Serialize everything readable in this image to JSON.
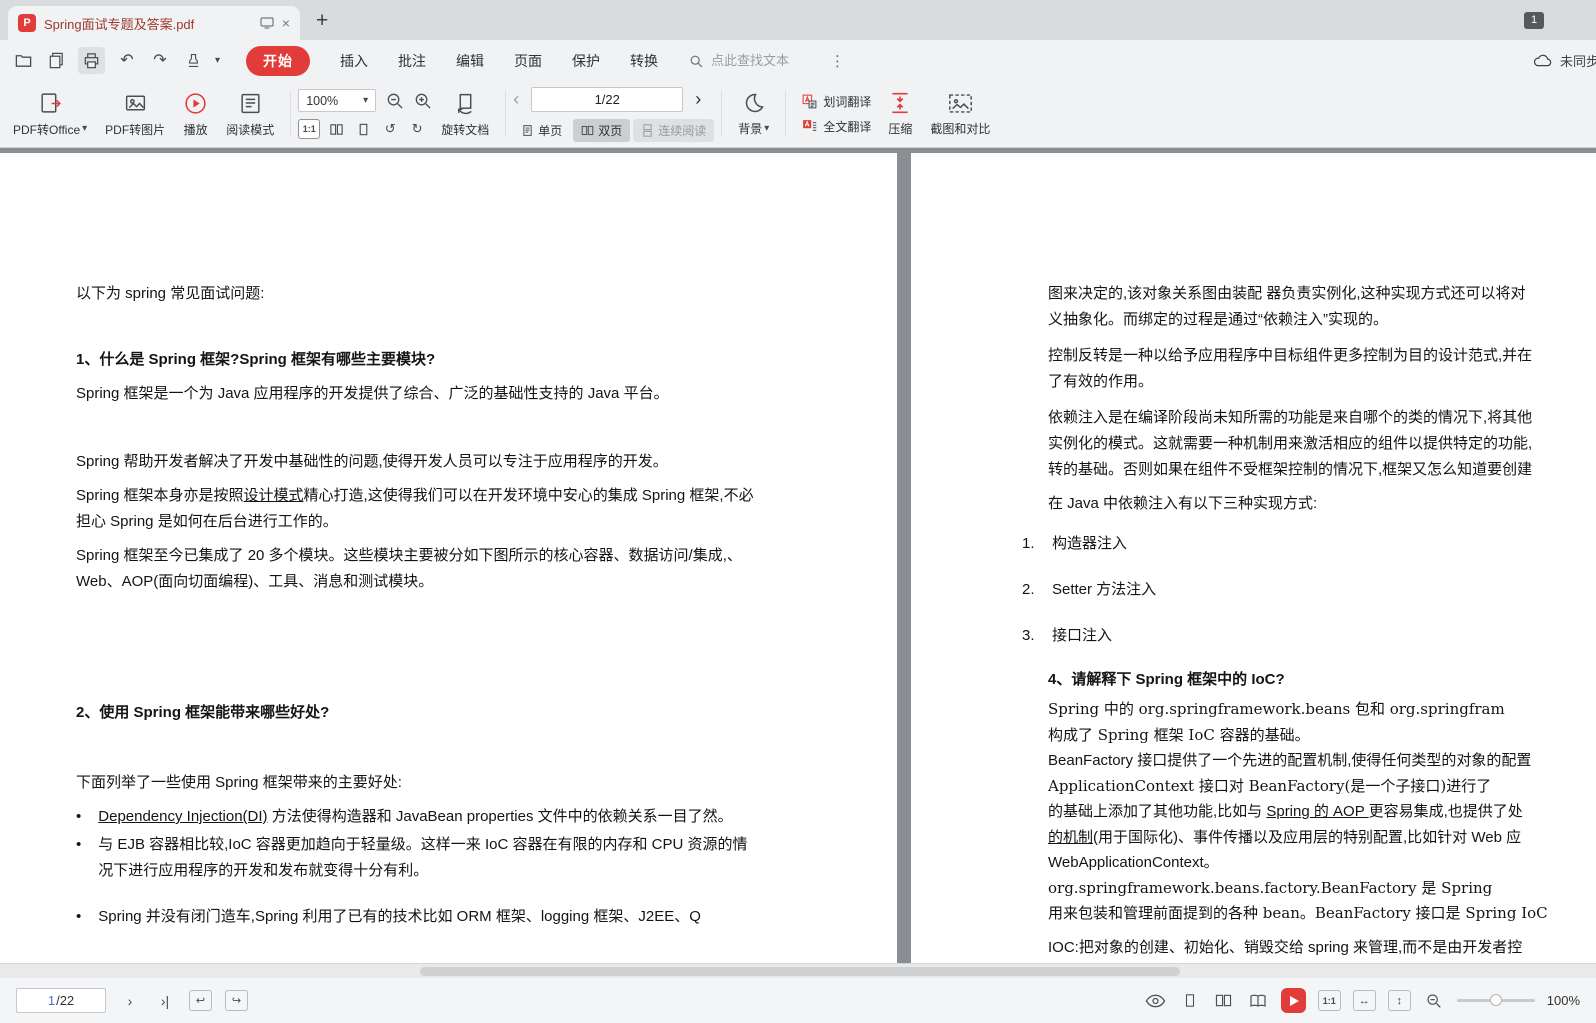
{
  "tabbar": {
    "title": "Spring面试专题及答案.pdf",
    "pdf_glyph": "P",
    "new_tab_label": "+",
    "window_badge": "1"
  },
  "ribbon": {
    "tabs": [
      {
        "label": "开始"
      },
      {
        "label": "插入"
      },
      {
        "label": "批注"
      },
      {
        "label": "编辑"
      },
      {
        "label": "页面"
      },
      {
        "label": "保护"
      },
      {
        "label": "转换"
      }
    ],
    "search_placeholder": "点此查找文本",
    "sync_status": "未同步"
  },
  "toolbar": {
    "pdf_to_office": "PDF转Office",
    "pdf_to_image": "PDF转图片",
    "play": "播放",
    "read_mode": "阅读模式",
    "zoom_value": "100%",
    "rotate_doc": "旋转文档",
    "page_current": "1",
    "page_total": "/22",
    "view_single": "单页",
    "view_double": "双页",
    "view_continuous": "连续阅读",
    "background": "背景",
    "word_translate": "划词翻译",
    "full_translate": "全文翻译",
    "compress": "压缩",
    "screenshot_compare": "截图和对比"
  },
  "icons": {
    "undo": "↶",
    "redo": "↷",
    "caret_down": "▾",
    "chevron_left": "‹",
    "chevron_right": "›",
    "kebab": "⋮",
    "close": "×",
    "next_page": "›",
    "last_page": "›|",
    "back_view": "↩",
    "forward_view": "↪",
    "rotate_left": "↺",
    "rotate_right": "↻",
    "fit_width": "↔",
    "fit_height": "↕",
    "bullet": "•"
  },
  "doc": {
    "left": {
      "intro": "以下为 spring 常见面试问题:",
      "h1": "1、什么是 Spring 框架?Spring 框架有哪些主要模块?",
      "p1": "Spring 框架是一个为 Java 应用程序的开发提供了综合、广泛的基础性支持的 Java 平台。",
      "p2": "Spring 帮助开发者解决了开发中基础性的问题,使得开发人员可以专注于应用程序的开发。",
      "p3_pre": "Spring 框架本身亦是按照",
      "p3_link": "设计模式",
      "p3_post": "精心打造,这使得我们可以在开发环境中安心的集成 Spring 框架,不必担心 Spring 是如何在后台进行工作的。",
      "p4": "Spring 框架至今已集成了 20 多个模块。这些模块主要被分如下图所示的核心容器、数据访问/集成,、Web、AOP(面向切面编程)、工具、消息和测试模块。",
      "h2": "2、使用 Spring 框架能带来哪些好处?",
      "p5": "下面列举了一些使用 Spring 框架带来的主要好处:",
      "b1_link": "Dependency Injection(DI)",
      "b1_post": " 方法使得构造器和 JavaBean properties 文件中的依赖关系一目了然。",
      "b2": "与 EJB 容器相比较,IoC 容器更加趋向于轻量级。这样一来 IoC 容器在有限的内存和 CPU 资源的情况下进行应用程序的开发和发布就变得十分有利。",
      "b3": "Spring 并没有闭门造车,Spring 利用了已有的技术比如 ORM 框架、logging 框架、J2EE、Q"
    },
    "right": {
      "l1": "图来决定的,该对象关系图由装配 器负责实例化,这种实现方式还可以将对",
      "l2": "义抽象化。而绑定的过程是通过“依赖注入”实现的。",
      "l3": "控制反转是一种以给予应用程序中目标组件更多控制为目的设计范式,并在",
      "l4": "了有效的作用。",
      "l5": "依赖注入是在编译阶段尚未知所需的功能是来自哪个的类的情况下,将其他",
      "l6": "实例化的模式。这就需要一种机制用来激活相应的组件以提供特定的功能,",
      "l7": "转的基础。否则如果在组件不受框架控制的情况下,框架又怎么知道要创建",
      "l8": "在 Java 中依赖注入有以下三种实现方式:",
      "list": [
        {
          "num": "1.",
          "text": "构造器注入"
        },
        {
          "num": "2.",
          "text": "Setter 方法注入"
        },
        {
          "num": "3.",
          "text": "接口注入"
        }
      ],
      "h4": "4、请解释下 Spring 框架中的 IoC?",
      "l9": "Spring 中的 org.springframework.beans 包和 org.springfram",
      "l10": "构成了 Spring 框架 IoC 容器的基础。",
      "l11": "BeanFactory 接口提供了一个先进的配置机制,使得任何类型的对象的配置",
      "l12": "ApplicationContext 接口对 BeanFactory(是一个子接口)进行了",
      "l13_pre": "的基础上添加了其他功能,比如与 ",
      "l13_link": "Spring 的 AOP ",
      "l13_post": "更容易集成,也提供了处",
      "l14_link": "的机制",
      "l14_post": "(用于国际化)、事件传播以及应用层的特别配置,比如针对 Web 应",
      "l15": "WebApplicationContext。",
      "l16": "org.springframework.beans.factory.BeanFactory 是 Spring",
      "l17": "用来包装和管理前面提到的各种 bean。BeanFactory 接口是 Spring IoC",
      "l18": "IOC:把对象的创建、初始化、销毁交给 spring 来管理,而不是由开发者控"
    }
  },
  "statusbar": {
    "page_current": "1",
    "page_total": "/22",
    "fit_actual": "1:1",
    "zoom_value": "100%"
  }
}
